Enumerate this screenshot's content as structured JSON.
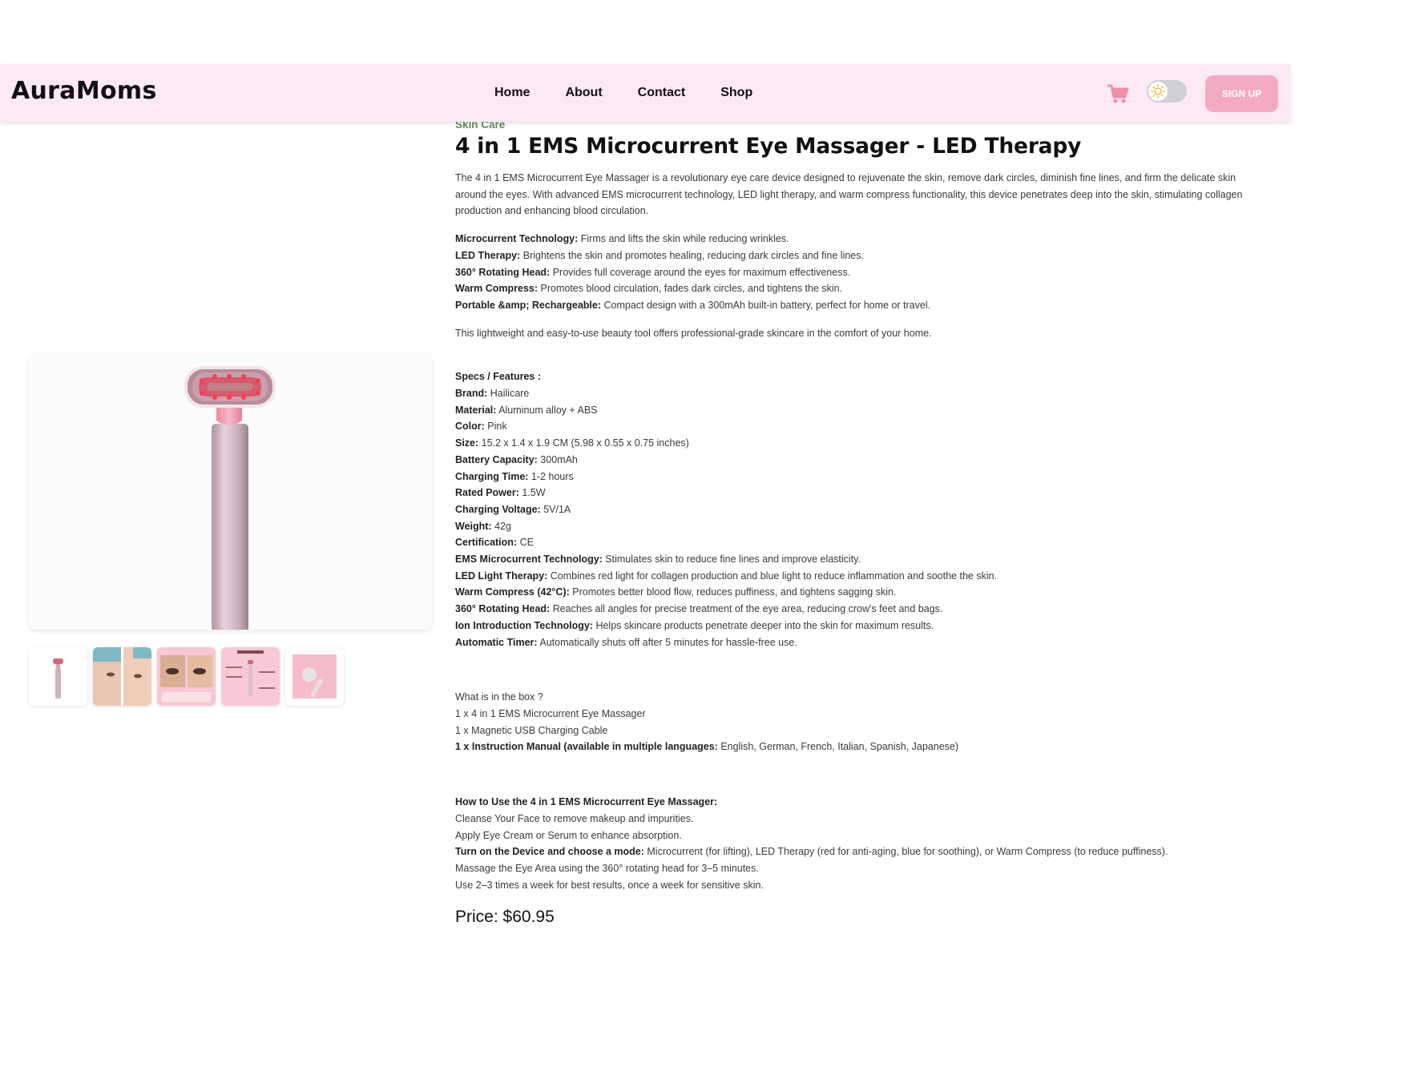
{
  "brand": "AuraMoms",
  "nav": {
    "home": "Home",
    "about": "About",
    "contact": "Contact",
    "shop": "Shop",
    "signup": "SIGN UP"
  },
  "colors": {
    "navbar_bg": "#fde8f6",
    "accent_pink": "#f2aac2",
    "cart_pink": "#ee8fac",
    "category_green": "#5f8f5f"
  },
  "icons": {
    "cart": "shopping-cart-icon",
    "theme": "sun-icon"
  },
  "product": {
    "category": "Skin Care",
    "title": "4 in 1 EMS Microcurrent Eye Massager - LED Therapy",
    "description": "The 4 in 1 EMS Microcurrent Eye Massager is a revolutionary eye care device designed to rejuvenate the skin, remove dark circles, diminish fine lines, and firm the delicate skin around the eyes. With advanced EMS microcurrent technology, LED light therapy, and warm compress functionality, this device penetrates deep into the skin, stimulating collagen production and enhancing blood circulation.",
    "highlights": [
      {
        "key": "Microcurrent Technology:",
        "text": " Firms and lifts the skin while reducing wrinkles."
      },
      {
        "key": "LED Therapy:",
        "text": " Brightens the skin and promotes healing, reducing dark circles and fine lines."
      },
      {
        "key": "360° Rotating Head:",
        "text": " Provides full coverage around the eyes for maximum effectiveness."
      },
      {
        "key": "Warm Compress:",
        "text": " Promotes blood circulation, fades dark circles, and tightens the skin."
      },
      {
        "key": "Portable &amp; Rechargeable:",
        "text": " Compact design with a 300mAh built-in battery, perfect for home or travel."
      }
    ],
    "summary": "This lightweight and easy-to-use beauty tool offers professional-grade skincare in the comfort of your home.",
    "specs_heading": "Specs / Features :",
    "specs": [
      {
        "key": "Brand:",
        "text": " Hailicare"
      },
      {
        "key": "Material:",
        "text": " Aluminum alloy + ABS"
      },
      {
        "key": "Color:",
        "text": " Pink"
      },
      {
        "key": "Size:",
        "text": " 15.2 x 1.4 x 1.9 CM (5.98 x 0.55 x 0.75 inches)"
      },
      {
        "key": "Battery Capacity:",
        "text": " 300mAh"
      },
      {
        "key": "Charging Time:",
        "text": " 1-2 hours"
      },
      {
        "key": "Rated Power:",
        "text": " 1.5W"
      },
      {
        "key": "Charging Voltage:",
        "text": " 5V/1A"
      },
      {
        "key": "Weight:",
        "text": " 42g"
      },
      {
        "key": "Certification:",
        "text": " CE"
      },
      {
        "key": "EMS Microcurrent Technology:",
        "text": " Stimulates skin to reduce fine lines and improve elasticity."
      },
      {
        "key": "LED Light Therapy:",
        "text": " Combines red light for collagen production and blue light to reduce inflammation and soothe the skin."
      },
      {
        "key": "Warm Compress (42°C):",
        "text": " Promotes better blood flow, reduces puffiness, and tightens sagging skin."
      },
      {
        "key": "360° Rotating Head:",
        "text": " Reaches all angles for precise treatment of the eye area, reducing crow's feet and bags."
      },
      {
        "key": "Ion Introduction Technology:",
        "text": " Helps skincare products penetrate deeper into the skin for maximum results."
      },
      {
        "key": "Automatic Timer:",
        "text": " Automatically shuts off after 5 minutes for hassle-free use."
      }
    ],
    "box_heading": "What is in the box ?",
    "box_items": [
      {
        "key": "",
        "text": "1 x 4 in 1 EMS Microcurrent Eye Massager"
      },
      {
        "key": "",
        "text": "1 x Magnetic USB Charging Cable"
      },
      {
        "key": "1 x Instruction Manual (available in multiple languages:",
        "text": " English, German, French, Italian, Spanish, Japanese)"
      }
    ],
    "howto_heading": "How to Use the 4 in 1 EMS Microcurrent Eye Massager:",
    "howto_steps": [
      {
        "key": "",
        "text": "Cleanse Your Face to remove makeup and impurities."
      },
      {
        "key": "",
        "text": "Apply Eye Cream or Serum to enhance absorption."
      },
      {
        "key": "Turn on the Device and choose a mode:",
        "text": " Microcurrent (for lifting), LED Therapy (red for anti-aging, blue for soothing), or Warm Compress (to reduce puffiness)."
      },
      {
        "key": "",
        "text": "Massage the Eye Area using the 360° rotating head for 3–5 minutes."
      },
      {
        "key": "",
        "text": "Use 2–3 times a week for best results, once a week for sensitive skin."
      }
    ],
    "price": "Price: $60.95"
  }
}
